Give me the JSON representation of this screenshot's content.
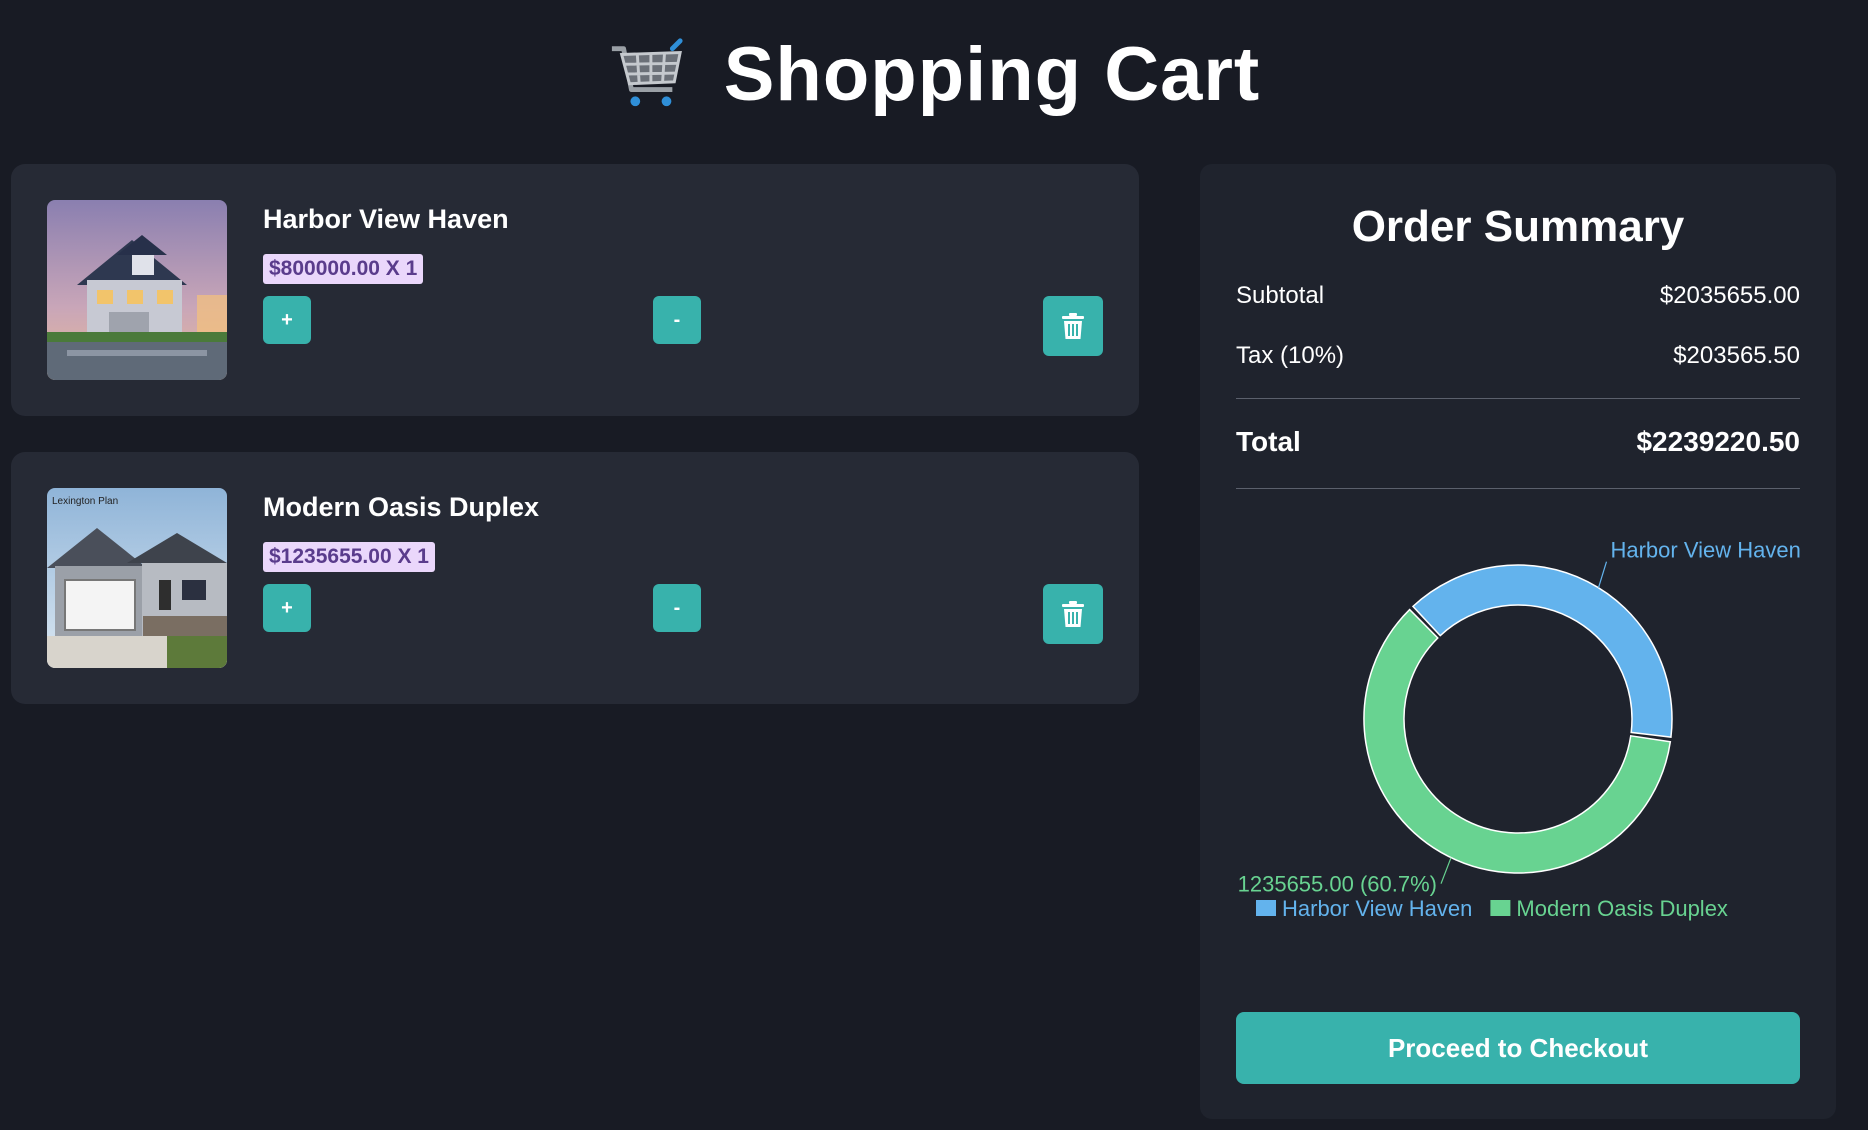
{
  "header": {
    "title": "Shopping Cart",
    "icon": "shopping-cart-icon"
  },
  "cart": {
    "items": [
      {
        "name": "Harbor View Haven",
        "price_qty": "$800000.00 X 1",
        "plus_label": "+",
        "minus_label": "-",
        "delete_icon": "trash-icon"
      },
      {
        "name": "Modern Oasis Duplex",
        "price_qty": "$1235655.00 X 1",
        "plus_label": "+",
        "minus_label": "-",
        "delete_icon": "trash-icon",
        "image_caption": "Lexington Plan"
      }
    ]
  },
  "summary": {
    "title": "Order Summary",
    "subtotal_label": "Subtotal",
    "subtotal_value": "$2035655.00",
    "tax_label": "Tax (10%)",
    "tax_value": "$203565.50",
    "total_label": "Total",
    "total_value": "$2239220.50",
    "checkout_label": "Proceed to Checkout"
  },
  "chart_data": {
    "type": "pie",
    "donut": true,
    "categories": [
      "Harbor View Haven",
      "Modern Oasis Duplex"
    ],
    "values": [
      800000,
      1235655
    ],
    "colors": [
      "#63b3ed",
      "#68d391"
    ],
    "data_labels": [
      "Harbor View Haven",
      "1235655.00 (60.7%)"
    ],
    "legend": [
      "Harbor View Haven",
      "Modern Oasis Duplex"
    ],
    "legend_position": "bottom"
  }
}
